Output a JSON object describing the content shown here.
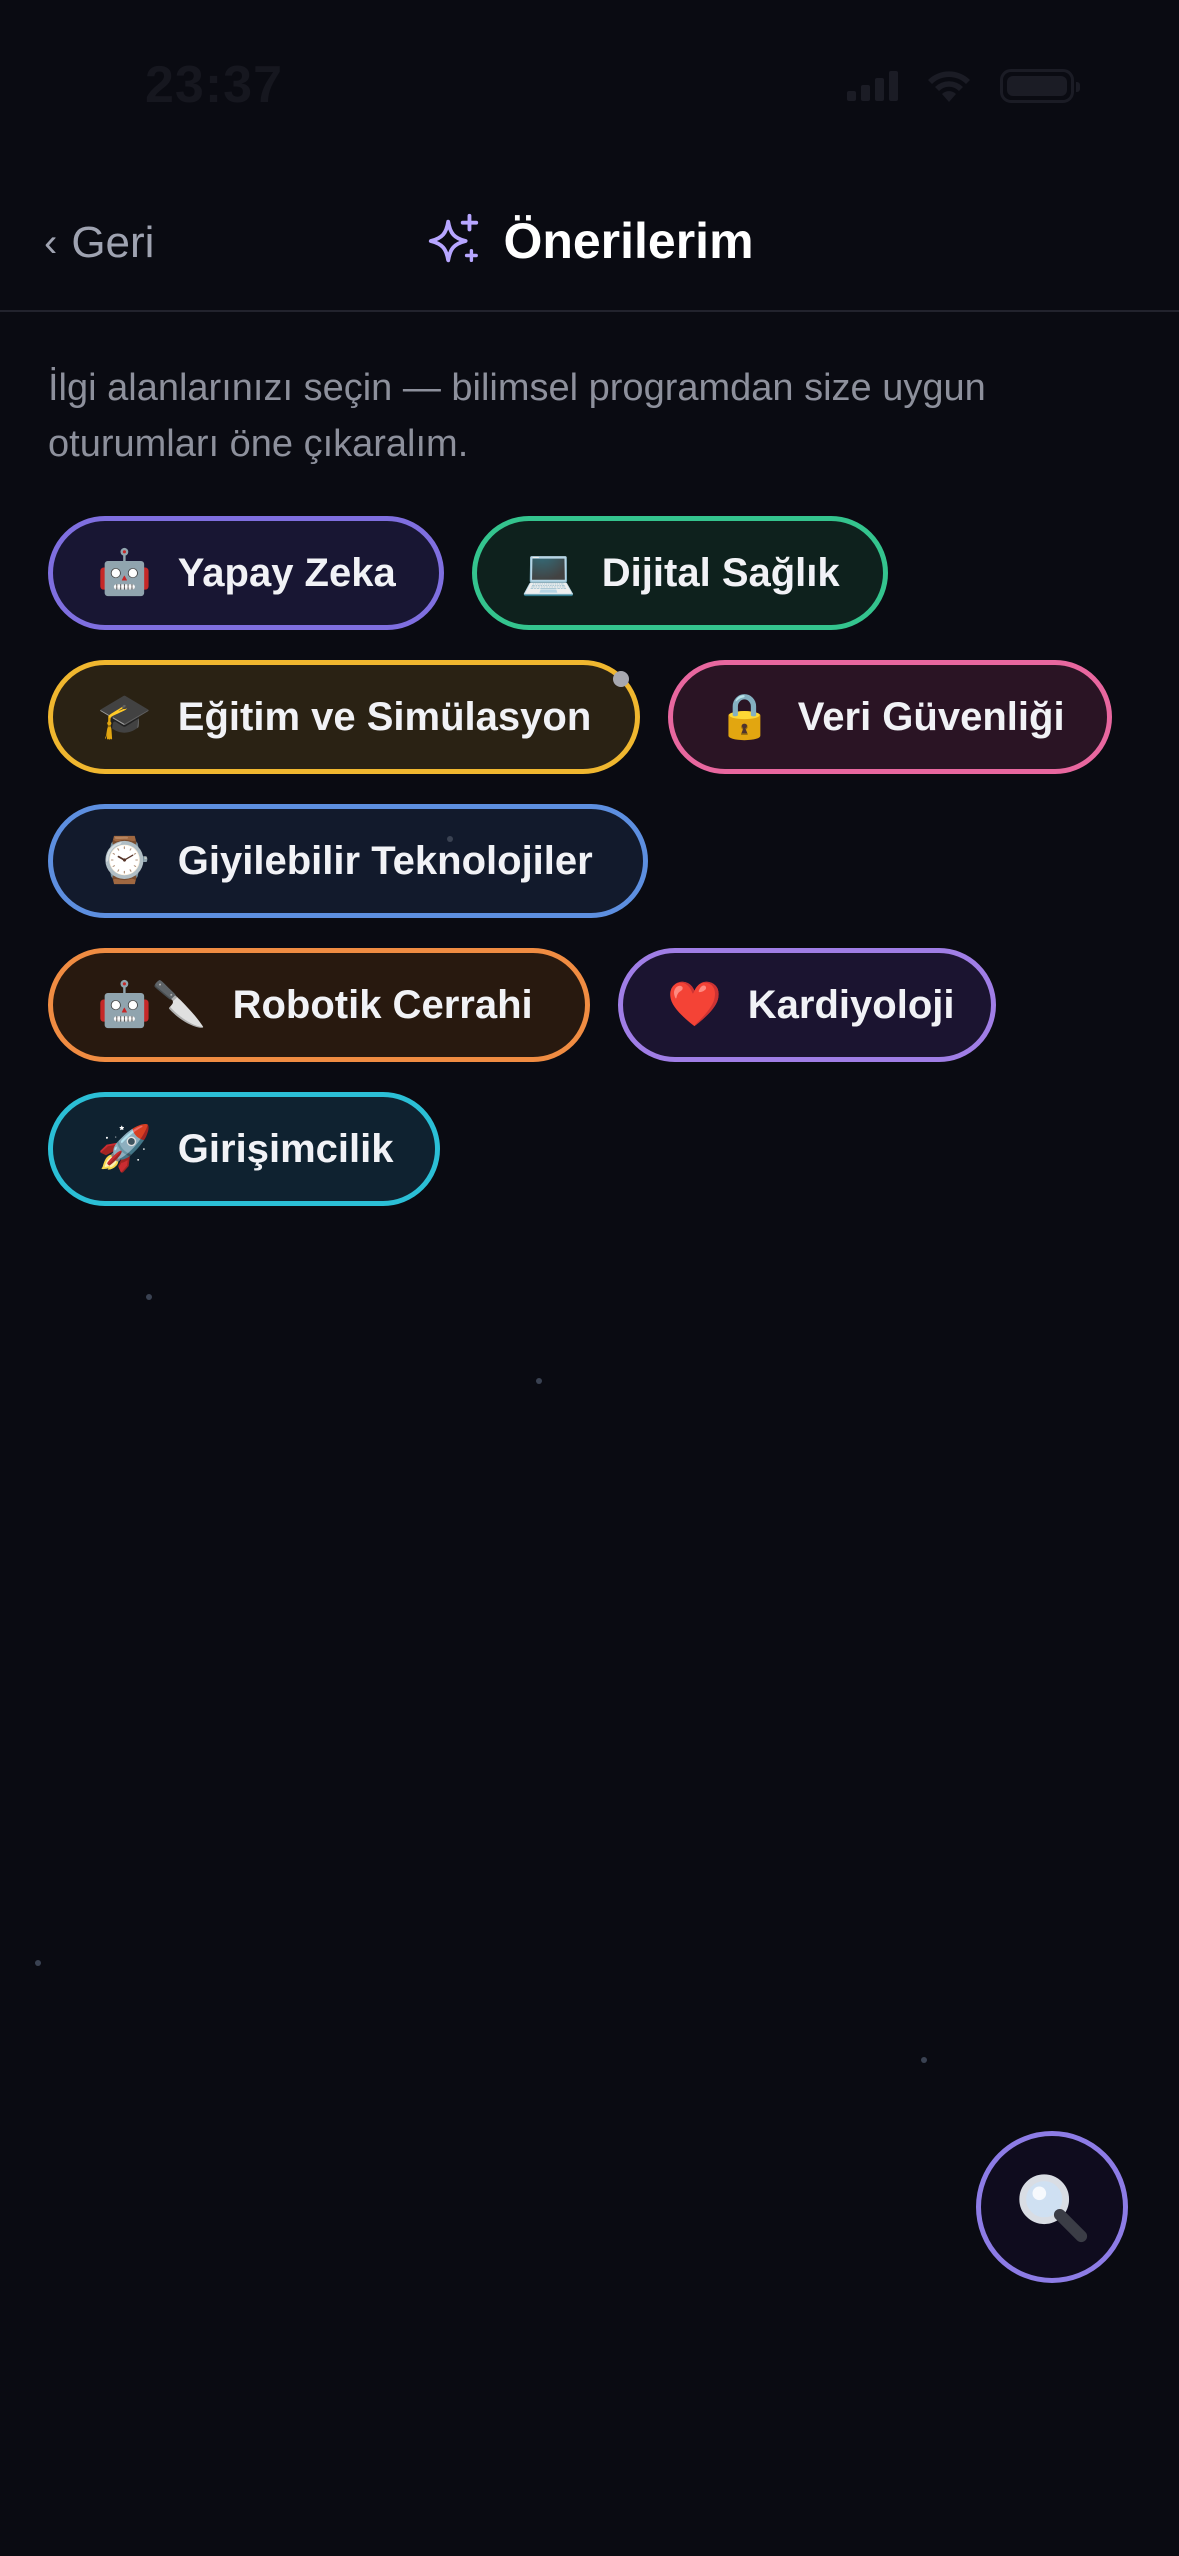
{
  "status": {
    "time": "23:37"
  },
  "nav": {
    "back_label": "Geri",
    "title": "Önerilerim"
  },
  "intro_text": "İlgi alanlarınızı seçin — bilimsel programdan size uygun oturumları öne çıkaralım.",
  "chips": [
    {
      "id": "ai",
      "icon": "🤖",
      "icon_name": "robot-icon",
      "label": "Yapay Zeka",
      "border": "#7f6fe0",
      "bg": "#181633"
    },
    {
      "id": "digital-health",
      "icon": "💻",
      "icon_name": "laptop-icon",
      "label": "Dijital Sağlık",
      "border": "#34c48e",
      "bg": "#0e211d"
    },
    {
      "id": "education",
      "icon": "🎓",
      "icon_name": "graduation-cap-icon",
      "label": "Eğitim ve Simülasyon",
      "border": "#f0b72f",
      "bg": "#2a2214"
    },
    {
      "id": "data-security",
      "icon": "🔒",
      "icon_name": "lock-icon",
      "label": "Veri Güvenliği",
      "border": "#e8679f",
      "bg": "#2a1424"
    },
    {
      "id": "wearables",
      "icon": "⌚",
      "icon_name": "watch-icon",
      "label": "Giyilebilir Teknolojiler",
      "border": "#5d8fe0",
      "bg": "#121a2c"
    },
    {
      "id": "robotic-surgery",
      "icon": "🤖🔪",
      "icon_name": "robot-knife-icon",
      "label": "Robotik Cerrahi",
      "border": "#f08c42",
      "bg": "#28190f"
    },
    {
      "id": "cardiology",
      "icon": "❤️",
      "icon_name": "heart-icon",
      "label": "Kardiyoloji",
      "border": "#a07ee6",
      "bg": "#1b1430"
    },
    {
      "id": "entrepreneurship",
      "icon": "🚀",
      "icon_name": "rocket-icon",
      "label": "Girişimcilik",
      "border": "#2bbfd6",
      "bg": "#0f2230"
    }
  ],
  "colors": {
    "background": "#0a0b12",
    "accent": "#8d7ce6",
    "muted_text": "#8d909c"
  }
}
